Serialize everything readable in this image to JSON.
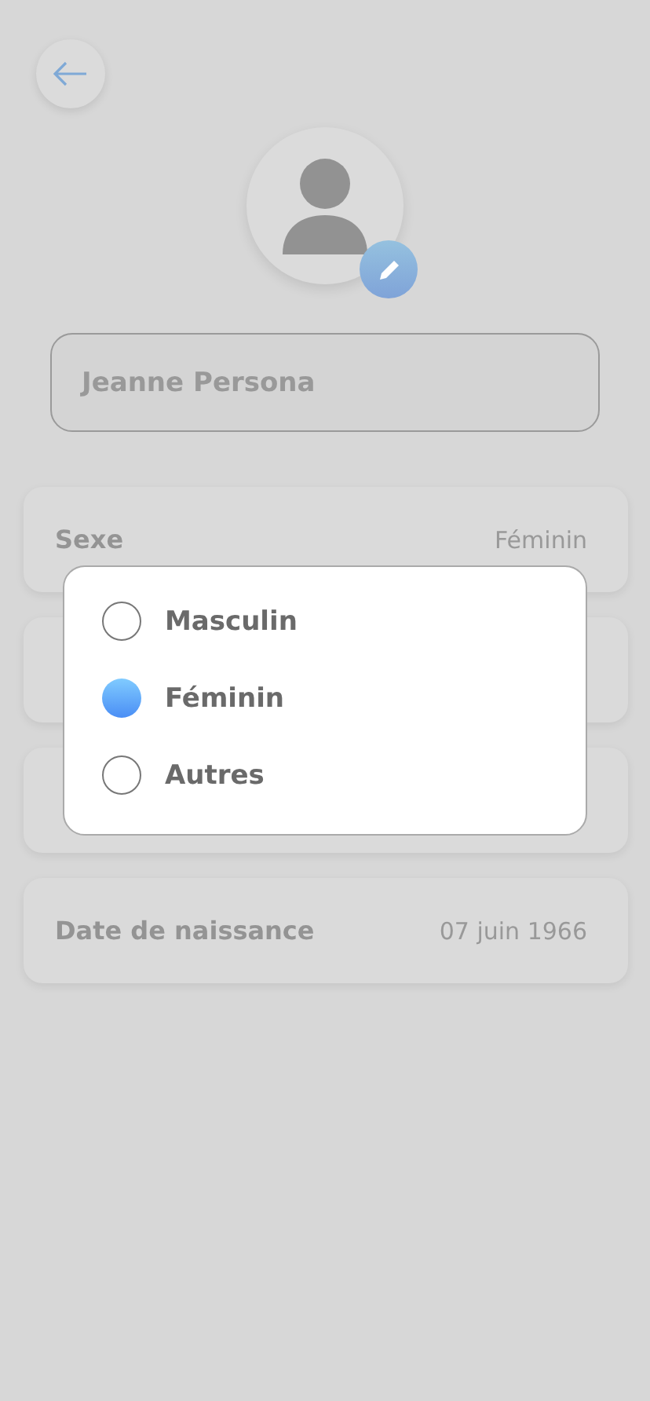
{
  "name_field": {
    "value": "Jeanne Persona"
  },
  "rows": [
    {
      "kind": "field",
      "label": "Sexe",
      "value": "Féminin"
    },
    {
      "kind": "covered"
    },
    {
      "kind": "covered"
    },
    {
      "kind": "field",
      "label": "Date de naissance",
      "value": "07 juin 1966"
    }
  ],
  "gender_dialog": {
    "options": [
      {
        "label": "Masculin",
        "selected": false
      },
      {
        "label": "Féminin",
        "selected": true
      },
      {
        "label": "Autres",
        "selected": false
      }
    ]
  }
}
